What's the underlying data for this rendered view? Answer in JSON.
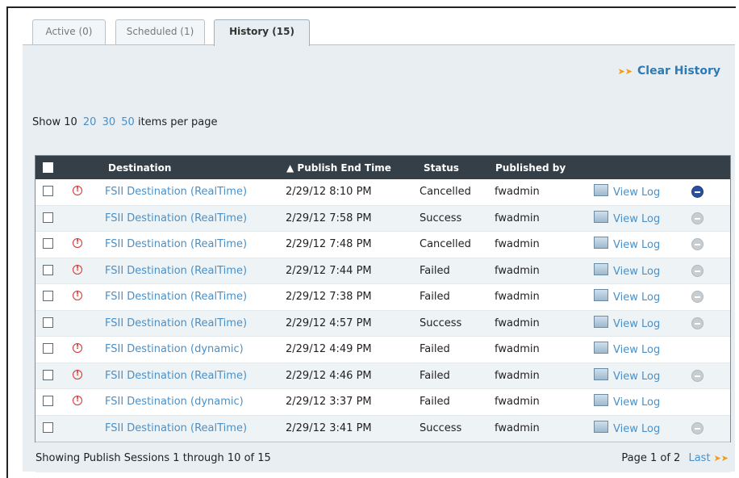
{
  "tabs": [
    {
      "label": "Active (0)"
    },
    {
      "label": "Scheduled (1)"
    },
    {
      "label": "History (15)"
    }
  ],
  "clear_history": "Clear History",
  "perpage": {
    "prefix": "Show 10",
    "opt20": "20",
    "opt30": "30",
    "opt50": "50",
    "suffix": "items per page"
  },
  "table": {
    "headers": {
      "destination": "Destination",
      "time": "▲ Publish End Time",
      "status": "Status",
      "published_by": "Published by"
    },
    "rows": [
      {
        "dest": "FSII Destination (RealTime)",
        "time": "2/29/12 8:10 PM",
        "status": "Cancelled",
        "by": "fwadmin",
        "log": "View Log"
      },
      {
        "dest": "FSII Destination (RealTime)",
        "time": "2/29/12 7:58 PM",
        "status": "Success",
        "by": "fwadmin",
        "log": "View Log"
      },
      {
        "dest": "FSII Destination (RealTime)",
        "time": "2/29/12 7:48 PM",
        "status": "Cancelled",
        "by": "fwadmin",
        "log": "View Log"
      },
      {
        "dest": "FSII Destination (RealTime)",
        "time": "2/29/12 7:44 PM",
        "status": "Failed",
        "by": "fwadmin",
        "log": "View Log"
      },
      {
        "dest": "FSII Destination (RealTime)",
        "time": "2/29/12 7:38 PM",
        "status": "Failed",
        "by": "fwadmin",
        "log": "View Log"
      },
      {
        "dest": "FSII Destination (RealTime)",
        "time": "2/29/12 4:57 PM",
        "status": "Success",
        "by": "fwadmin",
        "log": "View Log"
      },
      {
        "dest": "FSII Destination (dynamic)",
        "time": "2/29/12 4:49 PM",
        "status": "Failed",
        "by": "fwadmin",
        "log": "View Log"
      },
      {
        "dest": "FSII Destination (RealTime)",
        "time": "2/29/12 4:46 PM",
        "status": "Failed",
        "by": "fwadmin",
        "log": "View Log"
      },
      {
        "dest": "FSII Destination (dynamic)",
        "time": "2/29/12 3:37 PM",
        "status": "Failed",
        "by": "fwadmin",
        "log": "View Log"
      },
      {
        "dest": "FSII Destination (RealTime)",
        "time": "2/29/12 3:41 PM",
        "status": "Success",
        "by": "fwadmin",
        "log": "View Log"
      }
    ]
  },
  "footer": {
    "showing": "Showing Publish Sessions 1 through 10 of 15",
    "page": "Page 1 of 2",
    "last": "Last"
  },
  "colors": {
    "accent": "#4a90c8",
    "header_bg": "#343f47",
    "warn": "#d9302c",
    "arrow": "#f39c12"
  }
}
